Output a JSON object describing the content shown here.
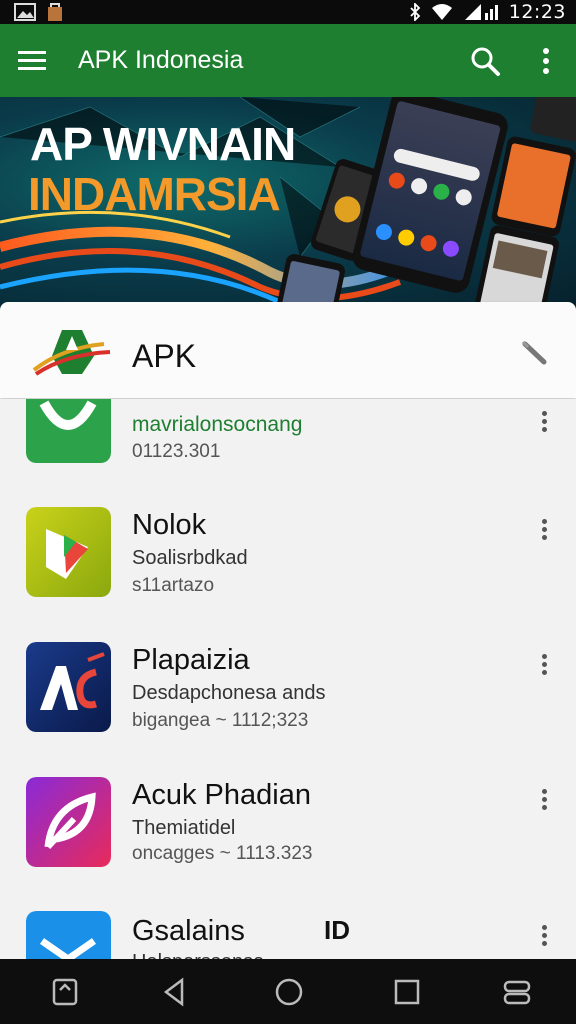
{
  "status_bar": {
    "time": "12:23",
    "icons": [
      "image-icon",
      "bag-icon",
      "bluetooth-icon",
      "wifi-icon",
      "signal-icon"
    ]
  },
  "app_bar": {
    "title": "APK Indonesia",
    "background": "#1d7f2f",
    "icons": [
      "menu-icon",
      "search-icon",
      "more-vert-icon"
    ]
  },
  "banner": {
    "line1": "AP WIVNAIN",
    "line2": "INDAMRSIA",
    "accent": "#f39a2a"
  },
  "section": {
    "label": "APK"
  },
  "apps": [
    {
      "name": "mavrialonsocnang",
      "meta": "01123.301",
      "icon": "green-check-icon",
      "name_color": "#1d7f2f"
    },
    {
      "name": "Nolok",
      "desc": "Soalisrbdkad",
      "meta": "s11artazo",
      "icon": "play-shield-icon"
    },
    {
      "name": "Plapaizia",
      "desc": "Desdapchonesa ands",
      "meta": "bigangea ~ 1112;323",
      "icon": "ac-logo-icon"
    },
    {
      "name": "Acuk Phadian",
      "desc": "Themiatidel",
      "meta": "oncagges ~ 1113.323",
      "icon": "leaf-icon"
    },
    {
      "name": "Gsalains",
      "desc": "Halsparssonsa",
      "badge": "ID",
      "icon": "blue-diamond-icon"
    }
  ],
  "nav_bar": {
    "icons": [
      "screenshot-icon",
      "back-icon",
      "home-icon",
      "recents-icon",
      "switch-icon"
    ]
  }
}
